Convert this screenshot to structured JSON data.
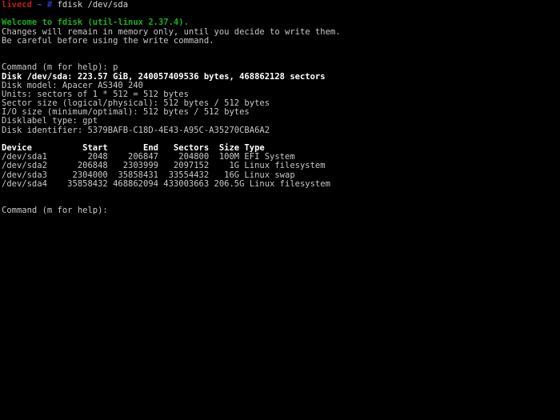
{
  "terminal": {
    "background_color": "#000000",
    "default_text_color": "#c8c8c8",
    "prompt": {
      "host": "livecd",
      "path": "~",
      "symbol": "#",
      "host_color": "#c01c1c",
      "path_color": "#8b2fa8",
      "symbol_color": "#2b39c4",
      "command": "fdisk /dev/sda"
    },
    "welcome": {
      "line1": "Welcome to fdisk (util-linux 2.37.4).",
      "line1_color": "#18b218",
      "line2": "Changes will remain in memory only, until you decide to write them.",
      "line3": "Be careful before using the write command."
    },
    "command_print": "Command (m for help): p",
    "disk_info": {
      "disk_line": "Disk /dev/sda: 223.57 GiB, 240057409536 bytes, 468862128 sectors",
      "disk_model": "Disk model: Apacer AS340 240",
      "units": "Units: sectors of 1 * 512 = 512 bytes",
      "sector_size": "Sector size (logical/physical): 512 bytes / 512 bytes",
      "io_size": "I/O size (minimum/optimal): 512 bytes / 512 bytes",
      "disklabel_type": "Disklabel type: gpt",
      "disk_identifier": "Disk identifier: 5379BAFB-C18D-4E43-A95C-A35270CBA6A2"
    },
    "partition_table": {
      "header": "Device          Start       End   Sectors  Size Type",
      "rows": [
        "/dev/sda1        2048    206847    204800  100M EFI System",
        "/dev/sda2      206848   2303999   2097152    1G Linux filesystem",
        "/dev/sda3     2304000  35858431  33554432   16G Linux swap",
        "/dev/sda4    35858432 468862094 433003663 206.5G Linux filesystem"
      ],
      "columns": [
        "Device",
        "Start",
        "End",
        "Sectors",
        "Size",
        "Type"
      ],
      "partitions": [
        {
          "device": "/dev/sda1",
          "start": "2048",
          "end": "206847",
          "sectors": "204800",
          "size": "100M",
          "type": "EFI System"
        },
        {
          "device": "/dev/sda2",
          "start": "206848",
          "end": "2303999",
          "sectors": "2097152",
          "size": "1G",
          "type": "Linux filesystem"
        },
        {
          "device": "/dev/sda3",
          "start": "2304000",
          "end": "35858431",
          "sectors": "33554432",
          "size": "16G",
          "type": "Linux swap"
        },
        {
          "device": "/dev/sda4",
          "start": "35858432",
          "end": "468862094",
          "sectors": "433003663",
          "size": "206.5G",
          "type": "Linux filesystem"
        }
      ]
    },
    "final_prompt": "Command (m for help):"
  }
}
